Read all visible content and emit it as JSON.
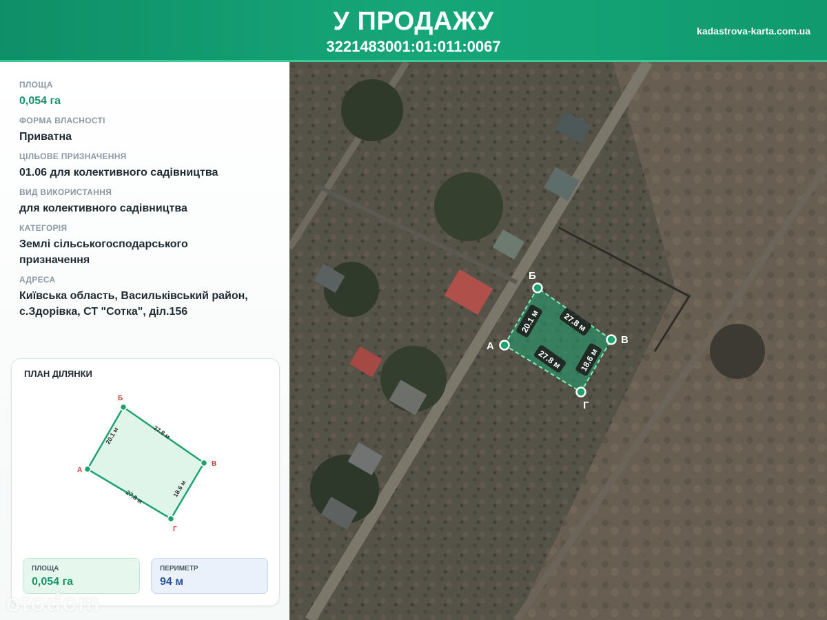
{
  "header": {
    "title": "У ПРОДАЖУ",
    "cadastral_number": "3221483001:01:011:0067",
    "site": "kadastrova-karta.com.ua"
  },
  "info": {
    "area_label": "ПЛОЩА",
    "area_value": "0,054 га",
    "ownership_label": "ФОРМА ВЛАСНОСТІ",
    "ownership_value": "Приватна",
    "purpose_label": "ЦІЛЬОВЕ ПРИЗНАЧЕННЯ",
    "purpose_value": "01.06 для колективного садівництва",
    "usage_label": "ВИД ВИКОРИСТАННЯ",
    "usage_value": "для колективного садівництва",
    "category_label": "КАТЕГОРІЯ",
    "category_value": "Землі сільськогосподарського призначення",
    "address_label": "АДРЕСА",
    "address_value": "Київська область, Васильківський район, с.Здорівка, СТ \"Сотка\", діл.156"
  },
  "plan": {
    "title": "ПЛАН ДІЛЯНКИ",
    "vertices": {
      "a": "А",
      "b": "Б",
      "v": "В",
      "g": "Г"
    },
    "sides": {
      "ab": "20.1 м",
      "bv": "27.8 м",
      "vg": "18.6 м",
      "ga": "27.8 м"
    },
    "area_label": "ПЛОЩА",
    "area_value": "0,054 га",
    "perimeter_label": "ПЕРИМЕТР",
    "perimeter_value": "94 м"
  },
  "map": {
    "vertices": {
      "a": "А",
      "b": "Б",
      "v": "В",
      "g": "Г"
    },
    "sides": {
      "ab": "20.1 м",
      "bv": "27.8 м",
      "vg": "18.6 м",
      "ga": "27.8 м"
    }
  },
  "watermark": "otodom",
  "colors": {
    "header_green": "#16a678",
    "parcel_green": "#1ea36f",
    "area_text": "#17936a",
    "perimeter_text": "#2a5298",
    "vertex_label_red": "#c0392b"
  }
}
